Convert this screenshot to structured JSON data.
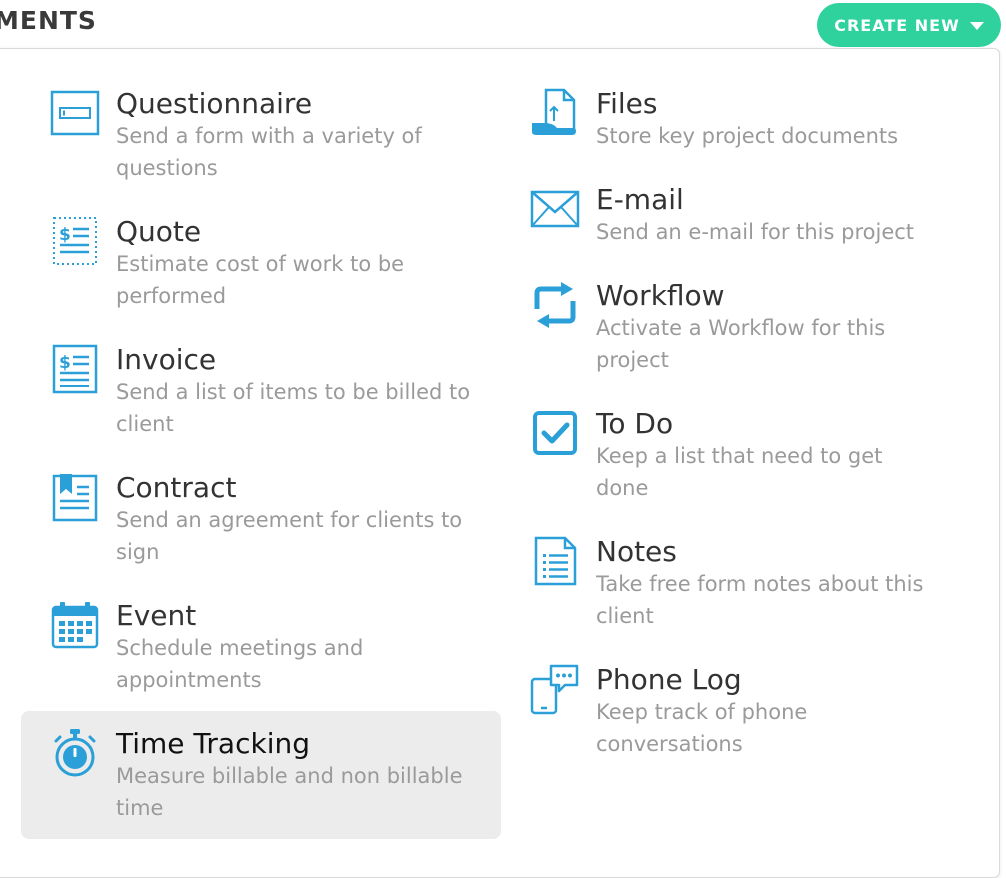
{
  "header": {
    "section_title": "MENTS",
    "create_new_label": "CREATE NEW"
  },
  "colors": {
    "accent": "#2fd29d",
    "icon_blue": "#2a9fd8",
    "highlight_bg": "#ececec"
  },
  "menu": {
    "left": [
      {
        "title": "Questionnaire",
        "description": "Send a form with a variety of questions",
        "icon": "questionnaire-icon"
      },
      {
        "title": "Quote",
        "description": "Estimate cost of work to be performed",
        "icon": "quote-icon"
      },
      {
        "title": "Invoice",
        "description": "Send a list of items to be billed to client",
        "icon": "invoice-icon"
      },
      {
        "title": "Contract",
        "description": "Send an agreement for clients to sign",
        "icon": "contract-icon"
      },
      {
        "title": "Event",
        "description": "Schedule meetings and appointments",
        "icon": "calendar-icon"
      },
      {
        "title": "Time Tracking",
        "description": "Measure billable and non billable time",
        "icon": "stopwatch-icon"
      }
    ],
    "right": [
      {
        "title": "Files",
        "description": "Store key project documents",
        "icon": "file-upload-icon"
      },
      {
        "title": "E-mail",
        "description": "Send an e-mail for this project",
        "icon": "envelope-icon"
      },
      {
        "title": "Workflow",
        "description": "Activate a Workflow for this project",
        "icon": "workflow-icon"
      },
      {
        "title": "To Do",
        "description": "Keep a list that need to get done",
        "icon": "checkbox-icon"
      },
      {
        "title": "Notes",
        "description": "Take free form notes about this client",
        "icon": "notes-icon"
      },
      {
        "title": "Phone Log",
        "description": "Keep track of phone conversations",
        "icon": "phone-log-icon"
      }
    ]
  }
}
